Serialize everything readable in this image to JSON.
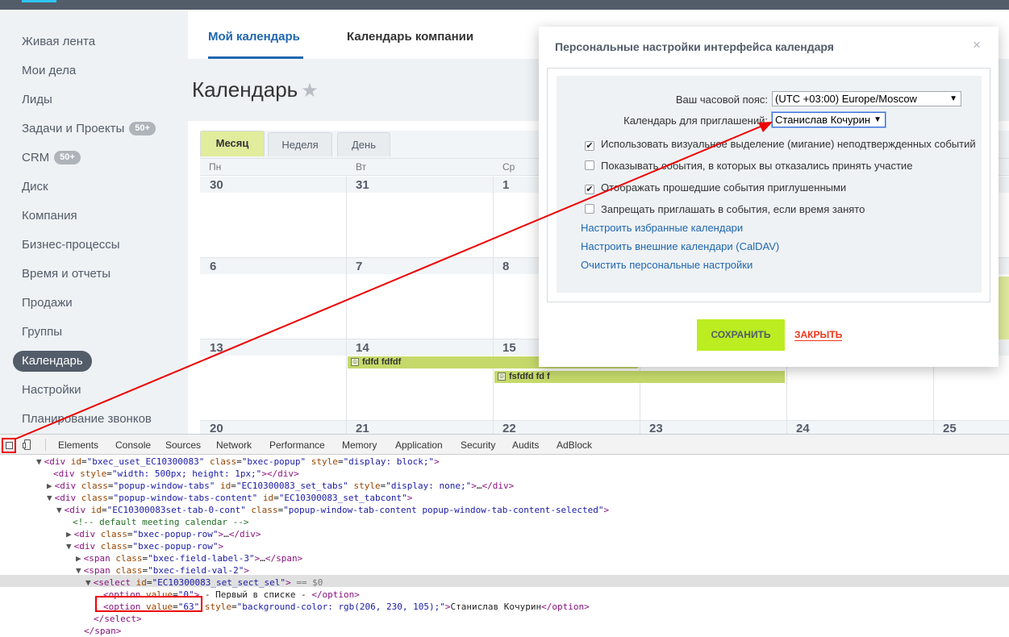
{
  "sidebar": {
    "items": [
      {
        "label": "Живая лента"
      },
      {
        "label": "Мои дела"
      },
      {
        "label": "Лиды"
      },
      {
        "label": "Задачи и Проекты",
        "badge": "50+"
      },
      {
        "label": "CRM",
        "badge": "50+"
      },
      {
        "label": "Диск"
      },
      {
        "label": "Компания"
      },
      {
        "label": "Бизнес-процессы"
      },
      {
        "label": "Время и отчеты"
      },
      {
        "label": "Продажи"
      },
      {
        "label": "Группы"
      },
      {
        "label": "Календарь",
        "active": true
      },
      {
        "label": "Настройки"
      },
      {
        "label": "Планирование звонков"
      }
    ]
  },
  "header": {
    "tabs": [
      {
        "label": "Мой календарь",
        "selected": true
      },
      {
        "label": "Календарь компании"
      }
    ],
    "page_title": "Календарь"
  },
  "calendar": {
    "view_tabs": [
      "Месяц",
      "Неделя",
      "День"
    ],
    "selected_view": "Месяц",
    "weekdays": [
      "Пн",
      "Вт",
      "Ср"
    ],
    "weeks": [
      [
        "30",
        "31",
        "1"
      ],
      [
        "6",
        "7",
        "8"
      ],
      [
        "13",
        "14",
        "15"
      ],
      [
        "20",
        "21",
        "22",
        "23",
        "24",
        "25"
      ]
    ],
    "events": [
      {
        "title": "fdfd fdfdf"
      },
      {
        "title": "fsfdfd fd f"
      }
    ]
  },
  "popup": {
    "title": "Персональные настройки интерфейса календаря",
    "close_glyph": "×",
    "timezone_label": "Ваш часовой пояс:",
    "timezone_value": "(UTC +03:00) Europe/Moscow",
    "invite_calendar_label": "Календарь для приглашений:",
    "invite_calendar_value": "Станислав Кочурин",
    "checkboxes": [
      {
        "label": "Использовать визуальное выделение (мигание) неподтвержденных событий",
        "checked": true
      },
      {
        "label": "Показывать события, в которых вы отказались принять участие",
        "checked": false
      },
      {
        "label": "Отображать прошедшие события приглушенными",
        "checked": true
      },
      {
        "label": "Запрещать приглашать в события, если время занято",
        "checked": false
      }
    ],
    "links": [
      "Настроить избранные календари",
      "Настроить внешние календари (CalDAV)",
      "Очистить персональные настройки"
    ],
    "save_label": "СОХРАНИТЬ",
    "close_label": "ЗАКРЫТЬ"
  },
  "devtools": {
    "tabs": [
      "Elements",
      "Console",
      "Sources",
      "Network",
      "Performance",
      "Memory",
      "Application",
      "Security",
      "Audits",
      "AdBlock"
    ],
    "selected_tab": "Elements",
    "selected_marker": "== $0",
    "lines": [
      "<div id=\"bxec_uset_EC10300083\" class=\"bxec-popup\" style=\"display: block;\">",
      "<div style=\"width: 500px; height: 1px;\"></div>",
      "<div class=\"popup-window-tabs\" id=\"EC10300083_set_tabs\" style=\"display: none;\">…</div>",
      "<div class=\"popup-window-tabs-content\" id=\"EC10300083_set_tabcont\">",
      "<div id=\"EC10300083set-tab-0-cont\" class=\"popup-window-tab-content popup-window-tab-content-selected\">",
      "<!-- default meeting calendar -->",
      "<div class=\"bxec-popup-row\">…</div>",
      "<div class=\"bxec-popup-row\">",
      "<span class=\"bxec-field-label-3\">…</span>",
      "<span class=\"bxec-field-val-2\">",
      "<select id=\"EC10300083_set_sect_sel\">",
      "<option value=\"0\"> - Первый в списке - </option>",
      "<option value=\"63\" style=\"background-color: rgb(206, 230, 105);\">Станислав Кочурин</option>",
      "</select>",
      "</span>"
    ]
  },
  "colors": {
    "accent_blue": "#2067b0",
    "save_green": "#bbed21",
    "close_red": "#f0371b",
    "annotation_red": "#e00000"
  }
}
